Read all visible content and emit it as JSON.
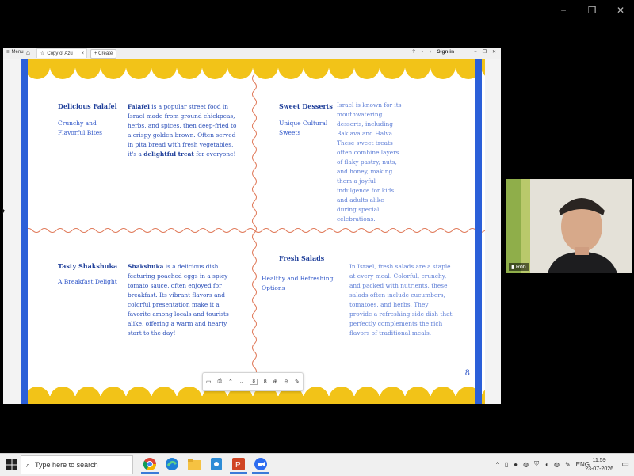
{
  "window_controls": {
    "minimize": "−",
    "restore": "❐",
    "close": "✕"
  },
  "browser": {
    "menu_label": "Menu",
    "tab_title": "Copy of Azu",
    "create_label": "+ Create",
    "sign_in": "Sign in"
  },
  "document": {
    "sections": [
      {
        "title": "Delicious Falafel",
        "subtitle": "Crunchy and Flavorful Bites",
        "body_bold_1": "Falafel",
        "body_1": " is a popular street food in Israel made from ground chickpeas, herbs, and spices, then deep-fried to a crispy golden brown. Often served in pita bread with fresh vegetables, it's a ",
        "body_bold_2": "delightful treat",
        "body_2": " for everyone!"
      },
      {
        "title": "Sweet Desserts",
        "subtitle": "Unique Cultural Sweets",
        "body": "Israel is known for its mouthwatering desserts, including Baklava and Halva. These sweet treats often combine layers of flaky pastry, nuts, and honey, making them a joyful indulgence for kids and adults alike during special celebrations."
      },
      {
        "title": "Tasty Shakshuka",
        "subtitle": "A Breakfast Delight",
        "body_bold_1": "Shakshuka",
        "body_1": " is a delicious dish featuring poached eggs in a spicy tomato sauce, often enjoyed for breakfast. Its vibrant flavors and colorful presentation make it a favorite among locals and tourists alike, offering a warm and hearty start to the day!"
      },
      {
        "title": "Fresh Salads",
        "subtitle": "Healthy and Refreshing Options",
        "body": "In Israel, fresh salads are a staple at every meal. Colorful, crunchy, and packed with nutrients, these salads often include cucumbers, tomatoes, and herbs. They provide a refreshing side dish that perfectly complements the rich flavors of traditional meals."
      }
    ],
    "page_number": "8",
    "colors": {
      "scallop": "#f2c318",
      "side_bar": "#2b5fd8",
      "wave": "#e07a5a"
    }
  },
  "pdf_toolbar": {
    "page_field": "8",
    "page_total": "8"
  },
  "video": {
    "participant_name": "Ron"
  },
  "taskbar": {
    "search_placeholder": "Type here to search",
    "language": "ENG",
    "time": "11:59",
    "date": "23-07-2026"
  }
}
